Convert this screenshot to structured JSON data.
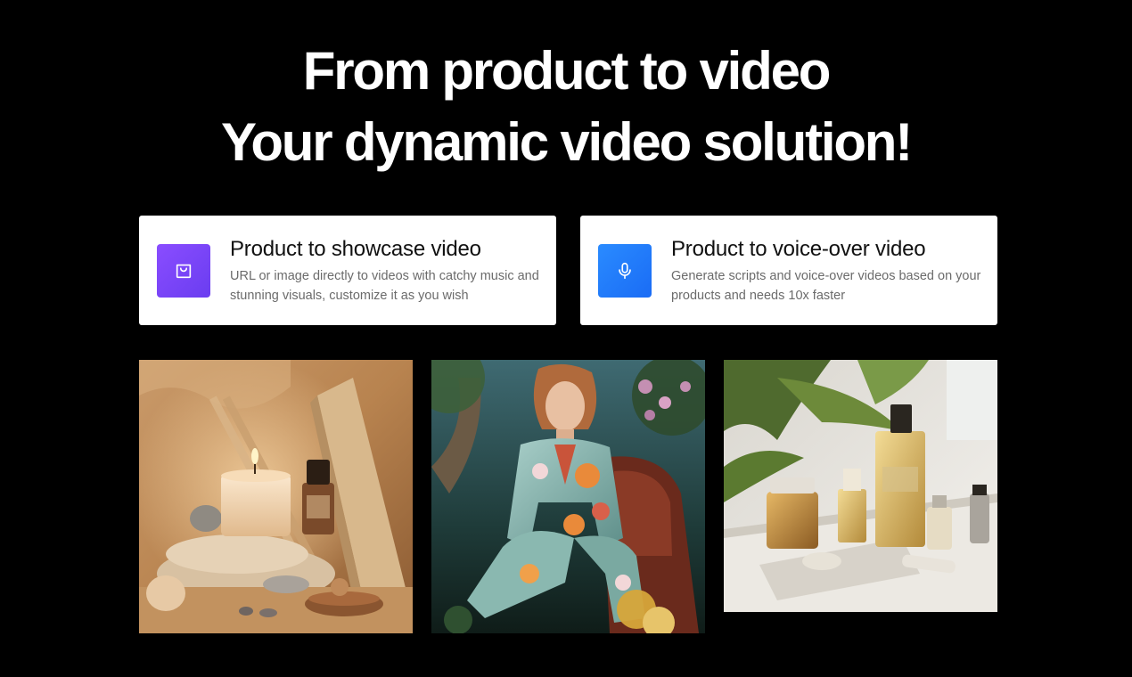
{
  "headline": {
    "line1": "From product to video",
    "line2": "Your dynamic video solution!"
  },
  "cards": [
    {
      "title": "Product to showcase video",
      "description": "URL or image directly to videos with catchy music and stunning visuals, customize it as you wish",
      "icon": "shopping-bag-icon",
      "color": "#7b45f7"
    },
    {
      "title": "Product to voice-over video",
      "description": "Generate scripts and voice-over videos based on your products and needs 10x faster",
      "icon": "microphone-icon",
      "color": "#1f7cfa"
    }
  ],
  "gallery": [
    {
      "subject": "candle-still-life-image"
    },
    {
      "subject": "floral-suit-model-image"
    },
    {
      "subject": "perfume-bottles-image"
    }
  ]
}
